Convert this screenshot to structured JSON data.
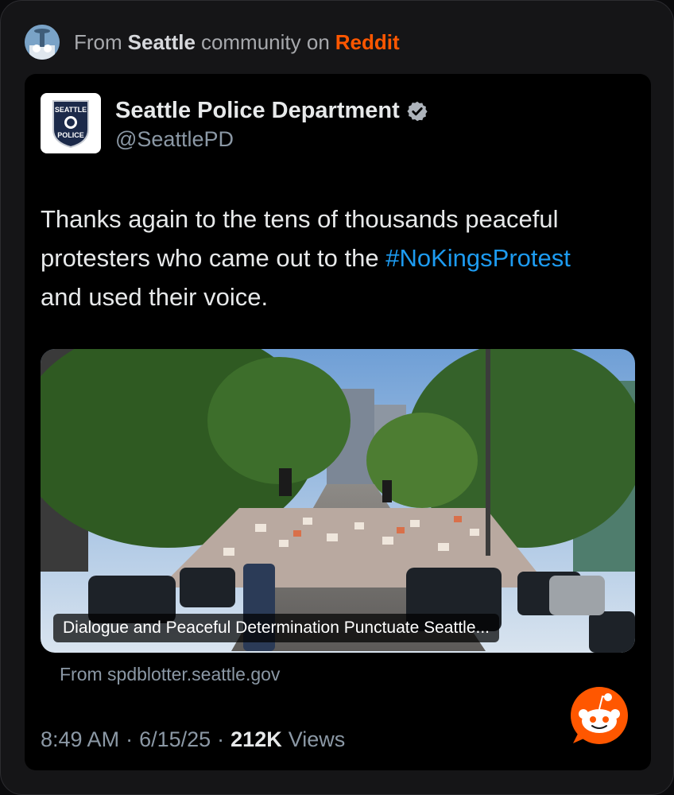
{
  "source": {
    "prefix": "From",
    "community": "Seattle",
    "middle": "community on",
    "platform": "Reddit"
  },
  "tweet": {
    "logo_text_top": "SEATTLE",
    "logo_text_bottom": "POLICE",
    "display_name": "Seattle Police Department",
    "handle": "@SeattlePD",
    "text_part1": "Thanks again to the tens of thousands peaceful protesters who came out to the",
    "hashtag": "#NoKingsProtest",
    "text_part2": "and used their voice.",
    "media_caption": "Dialogue and Peaceful Determination Punctuate Seattle...",
    "link_source": "From spdblotter.seattle.gov",
    "time": "8:49 AM",
    "date": "6/15/25",
    "views_count": "212K",
    "views_label": "Views"
  },
  "colors": {
    "reddit_orange": "#ff5700",
    "hashtag_blue": "#1d9bf0",
    "verified_gray": "#aeb4bb"
  },
  "icons": [
    "reddit-snoo-icon",
    "verified-badge-icon",
    "seattle-police-badge-logo"
  ]
}
